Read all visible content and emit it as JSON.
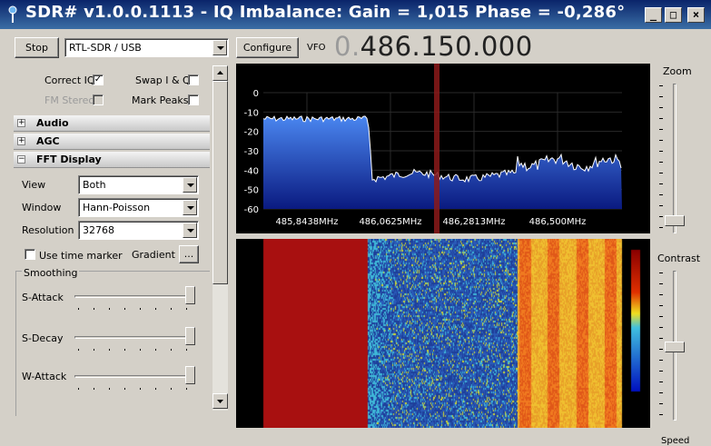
{
  "window": {
    "title": "SDR# v1.0.0.1113 - IQ Imbalance: Gain = 1,015 Phase = -0,286°",
    "minimize": "_",
    "maximize": "□",
    "close": "×"
  },
  "toolbar": {
    "stop_label": "Stop",
    "source_value": "RTL-SDR / USB",
    "configure_label": "Configure",
    "vfo_label": "VFO",
    "vfo_prefix": "0.",
    "vfo_value": "486.150.000"
  },
  "options": {
    "correct_iq": {
      "label": "Correct IQ",
      "checked": true
    },
    "swap_iq": {
      "label": "Swap I & Q",
      "checked": false
    },
    "fm_stereo": {
      "label": "FM Stereo",
      "checked": false,
      "disabled": true
    },
    "mark_peaks": {
      "label": "Mark Peaks",
      "checked": false
    }
  },
  "sections": {
    "audio": "Audio",
    "agc": "AGC",
    "fft": "FFT Display"
  },
  "fft": {
    "view_label": "View",
    "view_value": "Both",
    "window_label": "Window",
    "window_value": "Hann-Poisson",
    "resolution_label": "Resolution",
    "resolution_value": "32768",
    "time_marker_label": "Use  time marker",
    "gradient_label": "Gradient",
    "gradient_button": "...",
    "smoothing_label": "Smoothing",
    "sattack_label": "S-Attack",
    "sdecay_label": "S-Decay",
    "wattack_label": "W-Attack",
    "sattack_level": 0.98,
    "sdecay_level": 0.98,
    "wattack_level": 0.98
  },
  "right": {
    "zoom_label": "Zoom",
    "contrast_label": "Contrast",
    "speed_label": "Speed",
    "zoom_level": 0.0,
    "contrast_level": 0.56
  },
  "spectrum": {
    "y_ticks": [
      "0",
      "-10",
      "-20",
      "-30",
      "-40",
      "-50",
      "-60"
    ],
    "x_ticks": [
      "485,8438MHz",
      "486,0625MHz",
      "486,2813MHz",
      "486,500MHz"
    ],
    "colors": {
      "fill": "#2a5cd8",
      "trace": "#ffffff",
      "cursor": "#8b1a1a",
      "grid": "#2a2a2a"
    }
  },
  "icons": [
    "app-antenna-icon",
    "scroll-up-icon",
    "scroll-down-icon",
    "expand-icon",
    "collapse-icon"
  ]
}
